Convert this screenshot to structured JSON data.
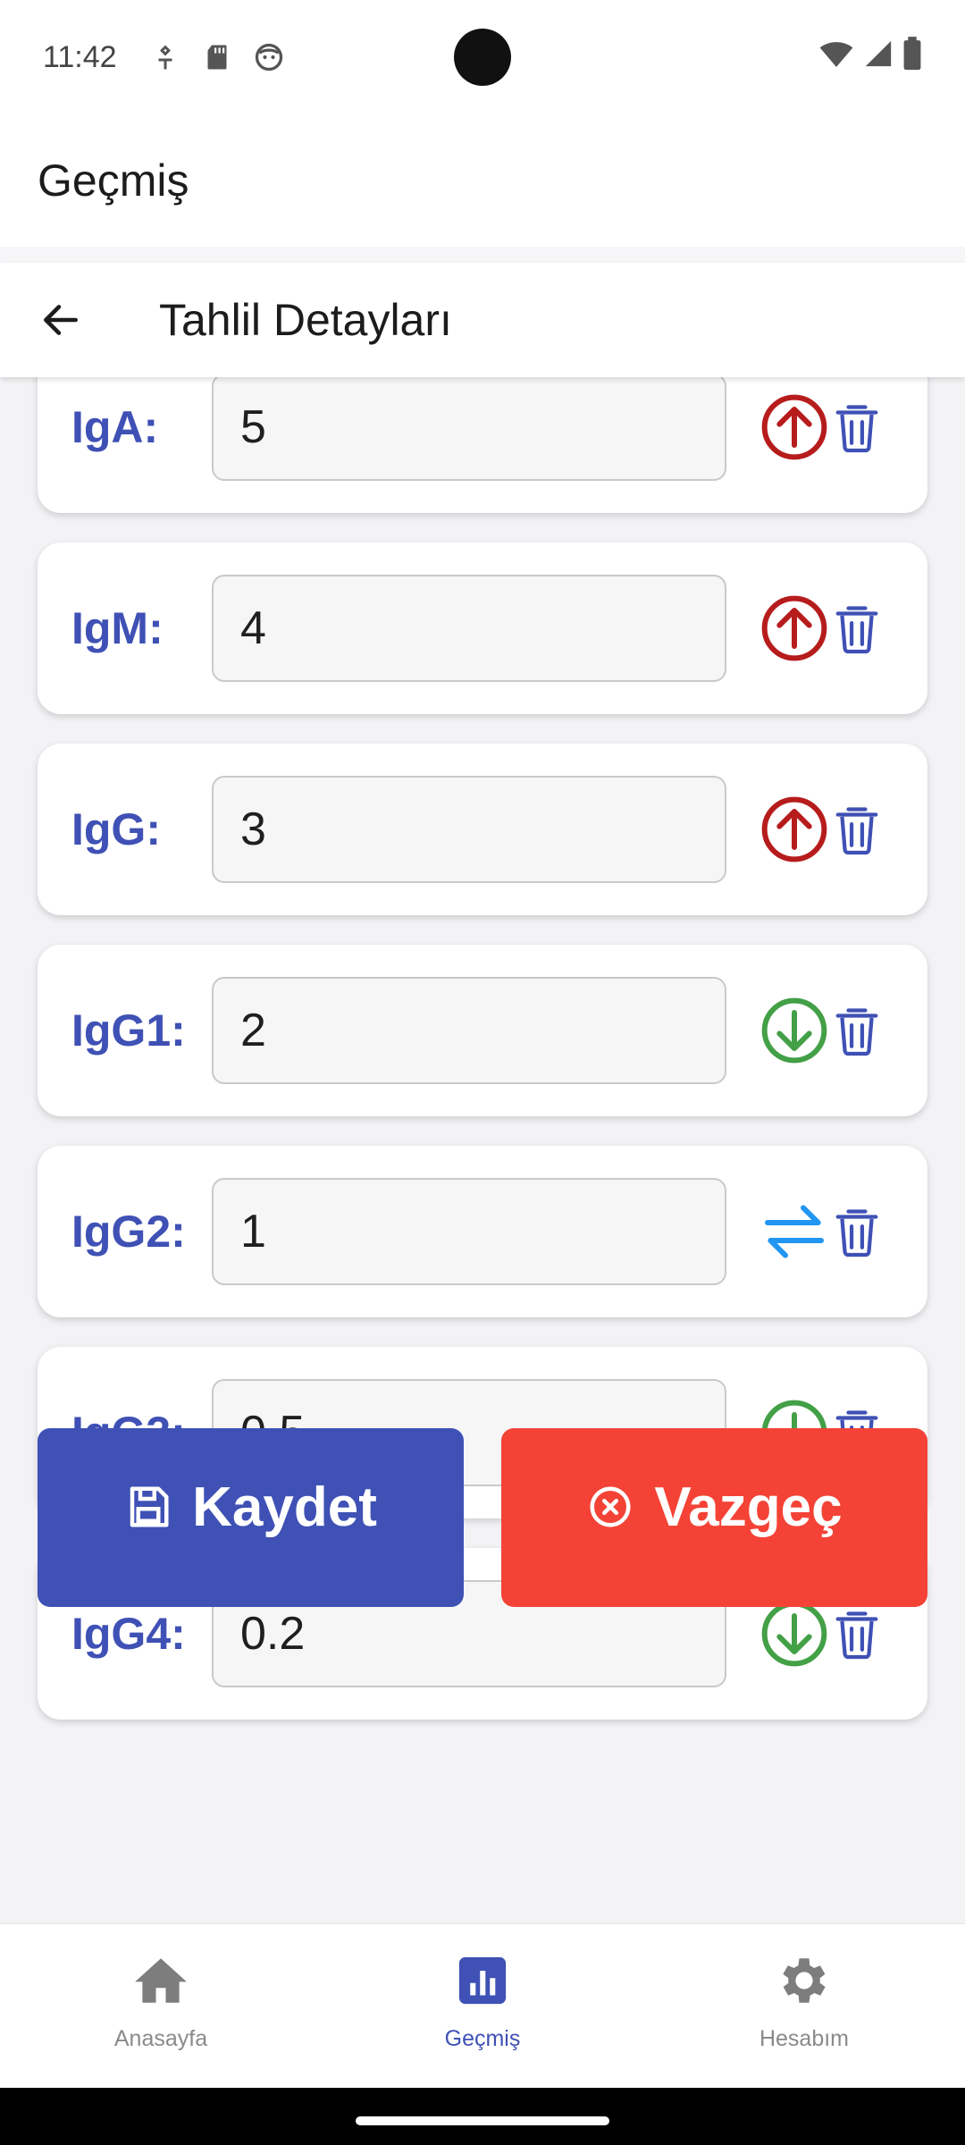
{
  "status_bar": {
    "time": "11:42"
  },
  "app_bar": {
    "title": "Geçmiş"
  },
  "sub_header": {
    "title": "Tahlil Detayları"
  },
  "colors": {
    "primary": "#3f51b5",
    "danger": "#f44336",
    "trend_up": "#b71c1c",
    "trend_down": "#43a047",
    "trend_neutral": "#2196f3"
  },
  "results": [
    {
      "label": "IgA:",
      "value": "5",
      "trend": "arrow-up-circle-icon"
    },
    {
      "label": "IgM:",
      "value": "4",
      "trend": "arrow-up-circle-icon"
    },
    {
      "label": "IgG:",
      "value": "3",
      "trend": "arrow-up-circle-icon"
    },
    {
      "label": "IgG1:",
      "value": "2",
      "trend": "arrow-down-circle-icon"
    },
    {
      "label": "IgG2:",
      "value": "1",
      "trend": "swap-horizontal-icon"
    },
    {
      "label": "IgG3:",
      "value": "0.5",
      "trend": "arrow-down-circle-icon"
    },
    {
      "label": "IgG4:",
      "value": "0.2",
      "trend": "arrow-down-circle-icon"
    }
  ],
  "actions": {
    "save_label": "Kaydet",
    "cancel_label": "Vazgeç"
  },
  "bottom_nav": [
    {
      "label": "Anasayfa",
      "icon": "home-icon",
      "active": false
    },
    {
      "label": "Geçmiş",
      "icon": "chart-box-icon",
      "active": true
    },
    {
      "label": "Hesabım",
      "icon": "gear-icon",
      "active": false
    }
  ]
}
